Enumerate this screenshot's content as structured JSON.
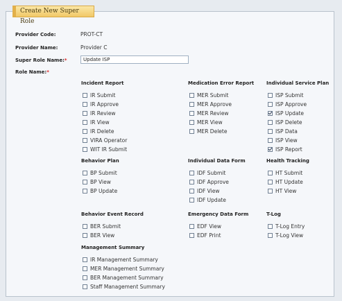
{
  "form": {
    "legend": "Create New Super Role",
    "fields": {
      "provider_code_label": "Provider Code:",
      "provider_code_value": "PROT-CT",
      "provider_name_label": "Provider Name:",
      "provider_name_value": "Provider C",
      "super_role_name_label": "Super Role Name:",
      "super_role_name_value": "Update ISP",
      "role_name_label": "Role Name:",
      "required_mark": "*"
    }
  },
  "groups": [
    {
      "key": "incident",
      "title": "Incident Report",
      "options": [
        {
          "label": "IR Submit",
          "checked": false
        },
        {
          "label": "IR Approve",
          "checked": false
        },
        {
          "label": "IR Review",
          "checked": false
        },
        {
          "label": "IR View",
          "checked": false
        },
        {
          "label": "IR Delete",
          "checked": false
        },
        {
          "label": "VIRA Operator",
          "checked": false
        },
        {
          "label": "WIT IR Submit",
          "checked": false
        }
      ]
    },
    {
      "key": "med",
      "title": "Medication Error Report",
      "options": [
        {
          "label": "MER Submit",
          "checked": false
        },
        {
          "label": "MER Approve",
          "checked": false
        },
        {
          "label": "MER Review",
          "checked": false
        },
        {
          "label": "MER View",
          "checked": false
        },
        {
          "label": "MER Delete",
          "checked": false
        }
      ]
    },
    {
      "key": "isp",
      "title": "Individual Service Plan",
      "options": [
        {
          "label": "ISP Submit",
          "checked": false
        },
        {
          "label": "ISP Approve",
          "checked": false
        },
        {
          "label": "ISP Update",
          "checked": true
        },
        {
          "label": "ISP Delete",
          "checked": false
        },
        {
          "label": "ISP Data",
          "checked": false
        },
        {
          "label": "ISP View",
          "checked": false
        },
        {
          "label": "ISP Report",
          "checked": true
        }
      ]
    },
    {
      "key": "bp",
      "title": "Behavior Plan",
      "options": [
        {
          "label": "BP Submit",
          "checked": false
        },
        {
          "label": "BP View",
          "checked": false
        },
        {
          "label": "BP Update",
          "checked": false
        }
      ]
    },
    {
      "key": "idf",
      "title": "Individual Data Form",
      "options": [
        {
          "label": "IDF Submit",
          "checked": false
        },
        {
          "label": "IDF Approve",
          "checked": false
        },
        {
          "label": "IDF View",
          "checked": false
        },
        {
          "label": "IDF Update",
          "checked": false
        }
      ]
    },
    {
      "key": "ht",
      "title": "Health Tracking",
      "options": [
        {
          "label": "HT Submit",
          "checked": false
        },
        {
          "label": "HT Update",
          "checked": false
        },
        {
          "label": "HT View",
          "checked": false
        }
      ]
    },
    {
      "key": "ber",
      "title": "Behavior Event Record",
      "options": [
        {
          "label": "BER Submit",
          "checked": false
        },
        {
          "label": "BER View",
          "checked": false
        }
      ]
    },
    {
      "key": "edf",
      "title": "Emergency Data Form",
      "options": [
        {
          "label": "EDF View",
          "checked": false
        },
        {
          "label": "EDF Print",
          "checked": false
        }
      ]
    },
    {
      "key": "tlog",
      "title": "T-Log",
      "options": [
        {
          "label": "T-Log Entry",
          "checked": false
        },
        {
          "label": "T-Log View",
          "checked": false
        }
      ]
    },
    {
      "key": "mgmt",
      "title": "Management Summary",
      "options": [
        {
          "label": "IR Management Summary",
          "checked": false
        },
        {
          "label": "MER Management Summary",
          "checked": false
        },
        {
          "label": "BER Management Summary",
          "checked": false
        },
        {
          "label": "Staff Management Summary",
          "checked": false
        }
      ]
    }
  ]
}
